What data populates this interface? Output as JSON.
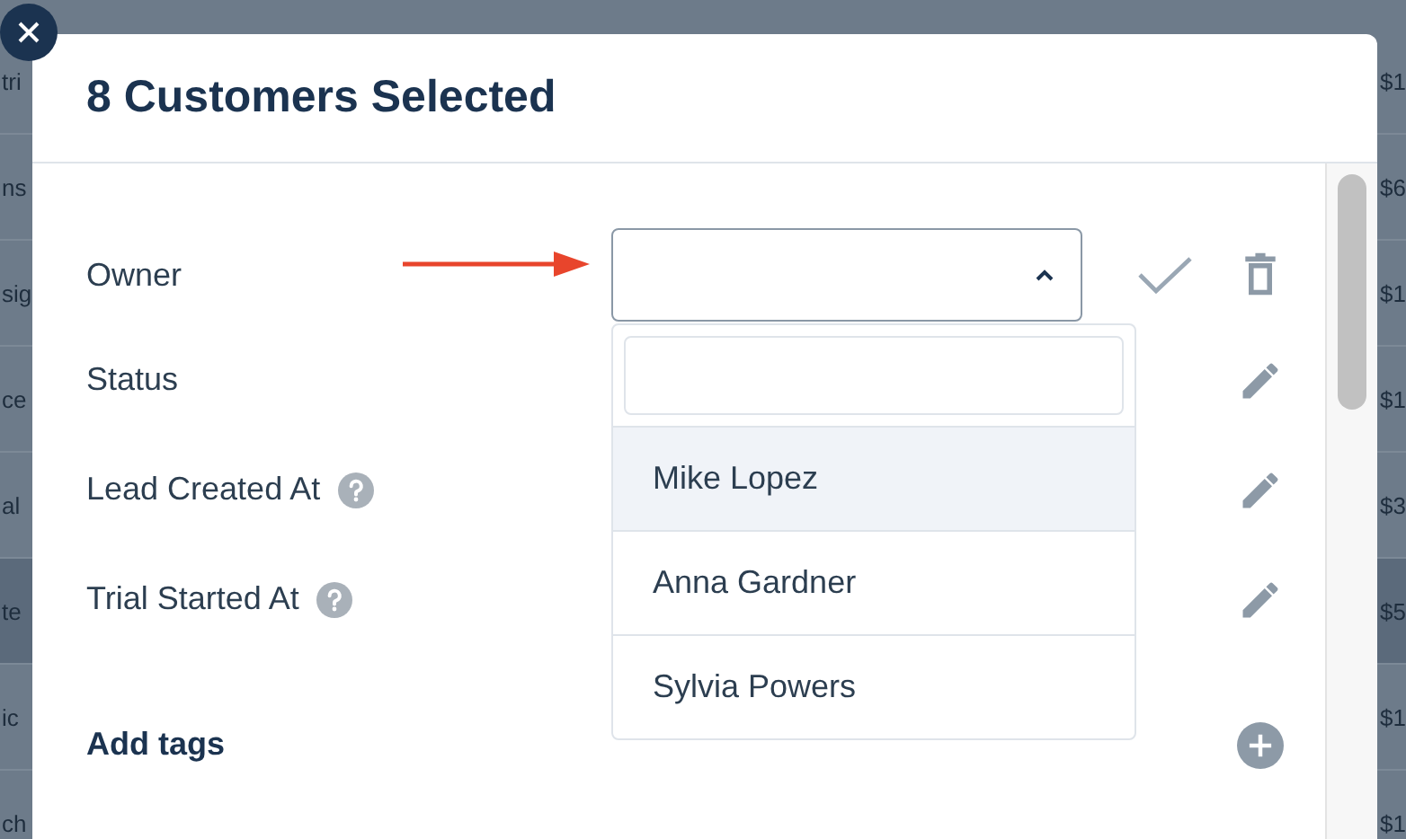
{
  "background_table": {
    "rows": [
      {
        "cell_1": "tri",
        "cell_2": "$1",
        "selected": false
      },
      {
        "cell_1": "ns",
        "cell_2": "$6",
        "selected": false
      },
      {
        "cell_1": "sig",
        "cell_2": "$1",
        "selected": false
      },
      {
        "cell_1": "ce",
        "cell_2": "$1",
        "selected": false
      },
      {
        "cell_1": "al",
        "cell_2": "$3",
        "selected": false
      },
      {
        "cell_1": "te",
        "cell_2": "$5",
        "selected": true
      },
      {
        "cell_1": "ic",
        "cell_2": "$1",
        "selected": false
      },
      {
        "cell_1": "ch",
        "cell_2": "$1",
        "selected": false
      }
    ]
  },
  "dialog": {
    "title": "8 Customers Selected",
    "fields": [
      {
        "label": "Owner",
        "kind": "select",
        "help": false,
        "confirm": true
      },
      {
        "label": "Status",
        "kind": "edit",
        "help": false,
        "confirm": false
      },
      {
        "label": "Lead Created At",
        "kind": "edit",
        "help": true,
        "confirm": false
      },
      {
        "label": "Trial Started At",
        "kind": "edit",
        "help": true,
        "confirm": false
      },
      {
        "label": "Add tags",
        "kind": "add",
        "help": false,
        "confirm": false
      }
    ],
    "dropdown": {
      "options": [
        {
          "label": "Mike Lopez",
          "selected": true
        },
        {
          "label": "Anna Gardner",
          "selected": false
        },
        {
          "label": "Sylvia Powers",
          "selected": false
        }
      ]
    }
  }
}
